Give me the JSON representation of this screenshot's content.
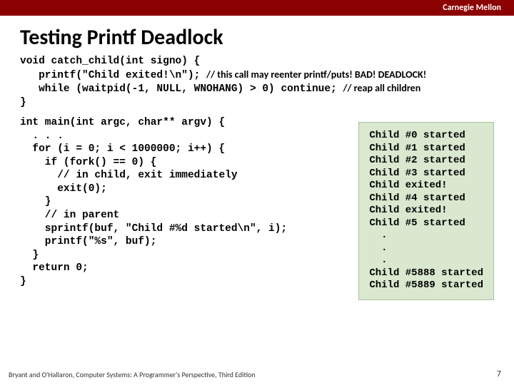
{
  "header": {
    "institution": "Carnegie Mellon"
  },
  "title": "Testing Printf Deadlock",
  "code1": {
    "l1": "void catch_child(int signo) {",
    "l2_code": "   printf(\"Child exited!\\n\"); ",
    "l2_comment": "// this call may reenter printf/puts! BAD! DEADLOCK!",
    "l3_code": "   while (waitpid(-1, NULL, WNOHANG) > 0) continue; ",
    "l3_comment": "// reap all children",
    "l4": "}"
  },
  "code2": {
    "l1": "int main(int argc, char** argv) {",
    "l2": "  . . .",
    "l3": "  for (i = 0; i < 1000000; i++) {",
    "l4": "    if (fork() == 0) {",
    "l5": "      // in child, exit immediately",
    "l6": "      exit(0);",
    "l7": "    }",
    "l8": "    // in parent",
    "l9": "    sprintf(buf, \"Child #%d started\\n\", i);",
    "l10": "    printf(\"%s\", buf);",
    "l11": "  }",
    "l12": "  return 0;",
    "l13": "}"
  },
  "output": "Child #0 started\nChild #1 started\nChild #2 started\nChild #3 started\nChild exited!\nChild #4 started\nChild exited!\nChild #5 started\n  .\n  .\n  .\nChild #5888 started\nChild #5889 started",
  "footer": "Bryant and O'Hallaron, Computer Systems: A Programmer's Perspective, Third Edition",
  "page": "7"
}
